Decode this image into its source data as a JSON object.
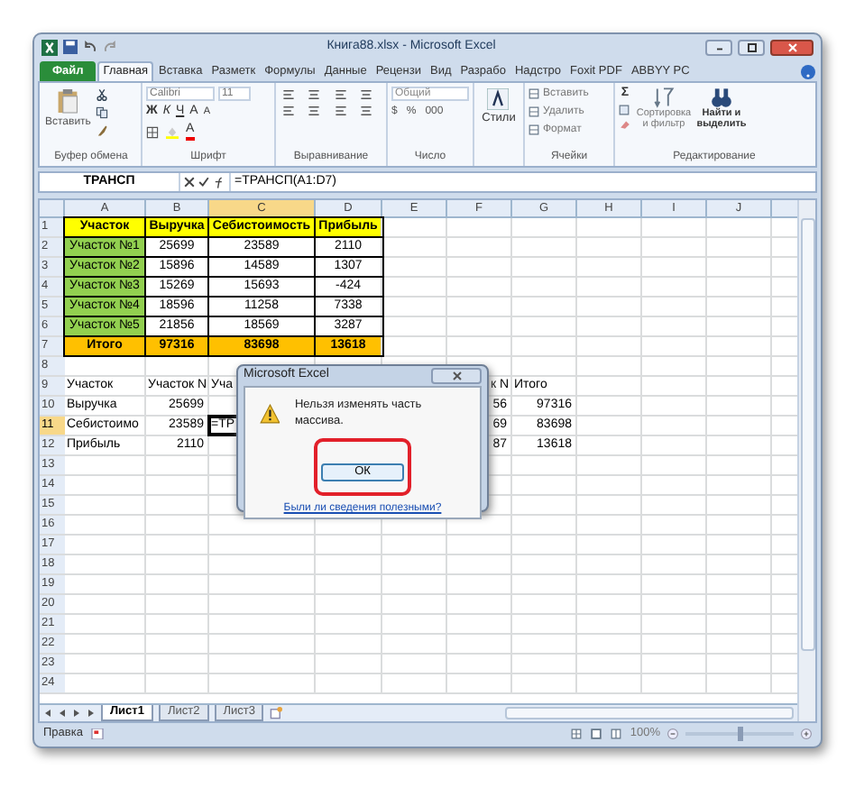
{
  "window": {
    "title": "Книга88.xlsx - Microsoft Excel"
  },
  "ribbon_tabs": [
    {
      "label": "Файл",
      "kind": "file",
      "selected": false
    },
    {
      "label": "Главная",
      "kind": "tab",
      "selected": true
    },
    {
      "label": "Вставка",
      "kind": "tab",
      "selected": false
    },
    {
      "label": "Разметк",
      "kind": "tab",
      "selected": false
    },
    {
      "label": "Формулы",
      "kind": "tab",
      "selected": false
    },
    {
      "label": "Данные",
      "kind": "tab",
      "selected": false
    },
    {
      "label": "Рецензи",
      "kind": "tab",
      "selected": false
    },
    {
      "label": "Вид",
      "kind": "tab",
      "selected": false
    },
    {
      "label": "Разрабо",
      "kind": "tab",
      "selected": false
    },
    {
      "label": "Надстро",
      "kind": "tab",
      "selected": false
    },
    {
      "label": "Foxit PDF",
      "kind": "tab",
      "selected": false
    },
    {
      "label": "ABBYY PC",
      "kind": "tab",
      "selected": false
    }
  ],
  "ribbon": {
    "clipboard": {
      "label": "Буфер обмена",
      "paste": "Вставить"
    },
    "font": {
      "label": "Шрифт",
      "font_name": "Calibri",
      "font_size": "11",
      "style_buttons": [
        "Ж",
        "К",
        "Ч"
      ],
      "size_buttons": [
        "A",
        "A"
      ],
      "color_button": "A"
    },
    "alignment": {
      "label": "Выравнивание"
    },
    "number": {
      "label": "Число",
      "format": "Общий",
      "buttons": [
        "$",
        "%",
        "000"
      ]
    },
    "styles": {
      "label": "Стили"
    },
    "cells": {
      "label": "Ячейки",
      "buttons": [
        "Вставить",
        "Удалить",
        "Формат"
      ]
    },
    "editing": {
      "label": "Редактирование",
      "sum": "Σ",
      "sort": "Сортировка и фильтр",
      "find": "Найти и выделить"
    }
  },
  "formula_bar": {
    "name_box": "ТРАНСП",
    "formula": "=ТРАНСП(A1:D7)"
  },
  "columns": [
    {
      "label": "A",
      "selected": false
    },
    {
      "label": "B",
      "selected": false
    },
    {
      "label": "C",
      "selected": true
    },
    {
      "label": "D",
      "selected": false
    },
    {
      "label": "E",
      "selected": false
    },
    {
      "label": "F",
      "selected": false
    },
    {
      "label": "G",
      "selected": false
    },
    {
      "label": "H",
      "selected": false
    },
    {
      "label": "I",
      "selected": false
    },
    {
      "label": "J",
      "selected": false
    }
  ],
  "rows": [
    {
      "header": "1",
      "selected": false,
      "cells": [
        {
          "text": "Участок",
          "kind": "header"
        },
        {
          "text": "Выручка",
          "kind": "header"
        },
        {
          "text": "Себистоимость",
          "kind": "header"
        },
        {
          "text": "Прибыль",
          "kind": "header"
        }
      ]
    },
    {
      "header": "2",
      "selected": false,
      "cells": [
        {
          "text": "Участок №1",
          "kind": "label"
        },
        {
          "text": "25699",
          "kind": "value"
        },
        {
          "text": "23589",
          "kind": "value"
        },
        {
          "text": "2110",
          "kind": "value"
        }
      ]
    },
    {
      "header": "3",
      "selected": false,
      "cells": [
        {
          "text": "Участок №2",
          "kind": "label"
        },
        {
          "text": "15896",
          "kind": "value"
        },
        {
          "text": "14589",
          "kind": "value"
        },
        {
          "text": "1307",
          "kind": "value"
        }
      ]
    },
    {
      "header": "4",
      "selected": false,
      "cells": [
        {
          "text": "Участок №3",
          "kind": "label"
        },
        {
          "text": "15269",
          "kind": "value"
        },
        {
          "text": "15693",
          "kind": "value"
        },
        {
          "text": "-424",
          "kind": "value"
        }
      ]
    },
    {
      "header": "5",
      "selected": false,
      "cells": [
        {
          "text": "Участок №4",
          "kind": "label"
        },
        {
          "text": "18596",
          "kind": "value"
        },
        {
          "text": "11258",
          "kind": "value"
        },
        {
          "text": "7338",
          "kind": "value"
        }
      ]
    },
    {
      "header": "6",
      "selected": false,
      "cells": [
        {
          "text": "Участок №5",
          "kind": "label"
        },
        {
          "text": "21856",
          "kind": "value"
        },
        {
          "text": "18569",
          "kind": "value"
        },
        {
          "text": "3287",
          "kind": "value"
        }
      ]
    },
    {
      "header": "7",
      "selected": false,
      "cells": [
        {
          "text": "Итого",
          "kind": "total"
        },
        {
          "text": "97316",
          "kind": "total"
        },
        {
          "text": "83698",
          "kind": "total"
        },
        {
          "text": "13618",
          "kind": "total"
        }
      ]
    },
    {
      "header": "8",
      "selected": false
    },
    {
      "header": "9",
      "selected": false,
      "cells": [
        {
          "text": "Участок",
          "kind": "text"
        },
        {
          "text": "Участок N",
          "kind": "text"
        },
        {
          "text": "Уча",
          "kind": "text"
        },
        null,
        null,
        {
          "text": "к N",
          "kind": "clipped"
        },
        {
          "text": "Итого",
          "kind": "text"
        }
      ]
    },
    {
      "header": "10",
      "selected": false,
      "cells": [
        {
          "text": "Выручка",
          "kind": "text"
        },
        {
          "text": "25699",
          "kind": "number"
        },
        null,
        null,
        null,
        {
          "text": "56",
          "kind": "number"
        },
        {
          "text": "97316",
          "kind": "number"
        }
      ]
    },
    {
      "header": "11",
      "selected": true,
      "cells": [
        {
          "text": "Себистоимо",
          "kind": "text"
        },
        {
          "text": "23589",
          "kind": "number"
        },
        {
          "text": "=ТР",
          "kind": "editing"
        },
        null,
        null,
        {
          "text": "69",
          "kind": "number"
        },
        {
          "text": "83698",
          "kind": "number"
        }
      ]
    },
    {
      "header": "12",
      "selected": false,
      "cells": [
        {
          "text": "Прибыль",
          "kind": "text"
        },
        {
          "text": "2110",
          "kind": "number"
        },
        null,
        null,
        null,
        {
          "text": "87",
          "kind": "number"
        },
        {
          "text": "13618",
          "kind": "number"
        }
      ]
    },
    {
      "header": "13",
      "selected": false
    },
    {
      "header": "14",
      "selected": false
    },
    {
      "header": "15",
      "selected": false
    },
    {
      "header": "16",
      "selected": false
    },
    {
      "header": "17",
      "selected": false
    },
    {
      "header": "18",
      "selected": false
    },
    {
      "header": "19",
      "selected": false
    },
    {
      "header": "20",
      "selected": false
    },
    {
      "header": "21",
      "selected": false
    },
    {
      "header": "22",
      "selected": false
    },
    {
      "header": "23",
      "selected": false
    },
    {
      "header": "24",
      "selected": false
    }
  ],
  "dialog": {
    "title": "Microsoft Excel",
    "message": "Нельзя изменять часть массива.",
    "button": "ОК",
    "link": "Были ли сведения полезными?"
  },
  "sheet_tabs": [
    {
      "label": "Лист1",
      "selected": true
    },
    {
      "label": "Лист2",
      "selected": false
    },
    {
      "label": "Лист3",
      "selected": false
    }
  ],
  "status_bar": {
    "mode": "Правка",
    "zoom": {
      "reading": "100%",
      "level": 0.5
    }
  }
}
